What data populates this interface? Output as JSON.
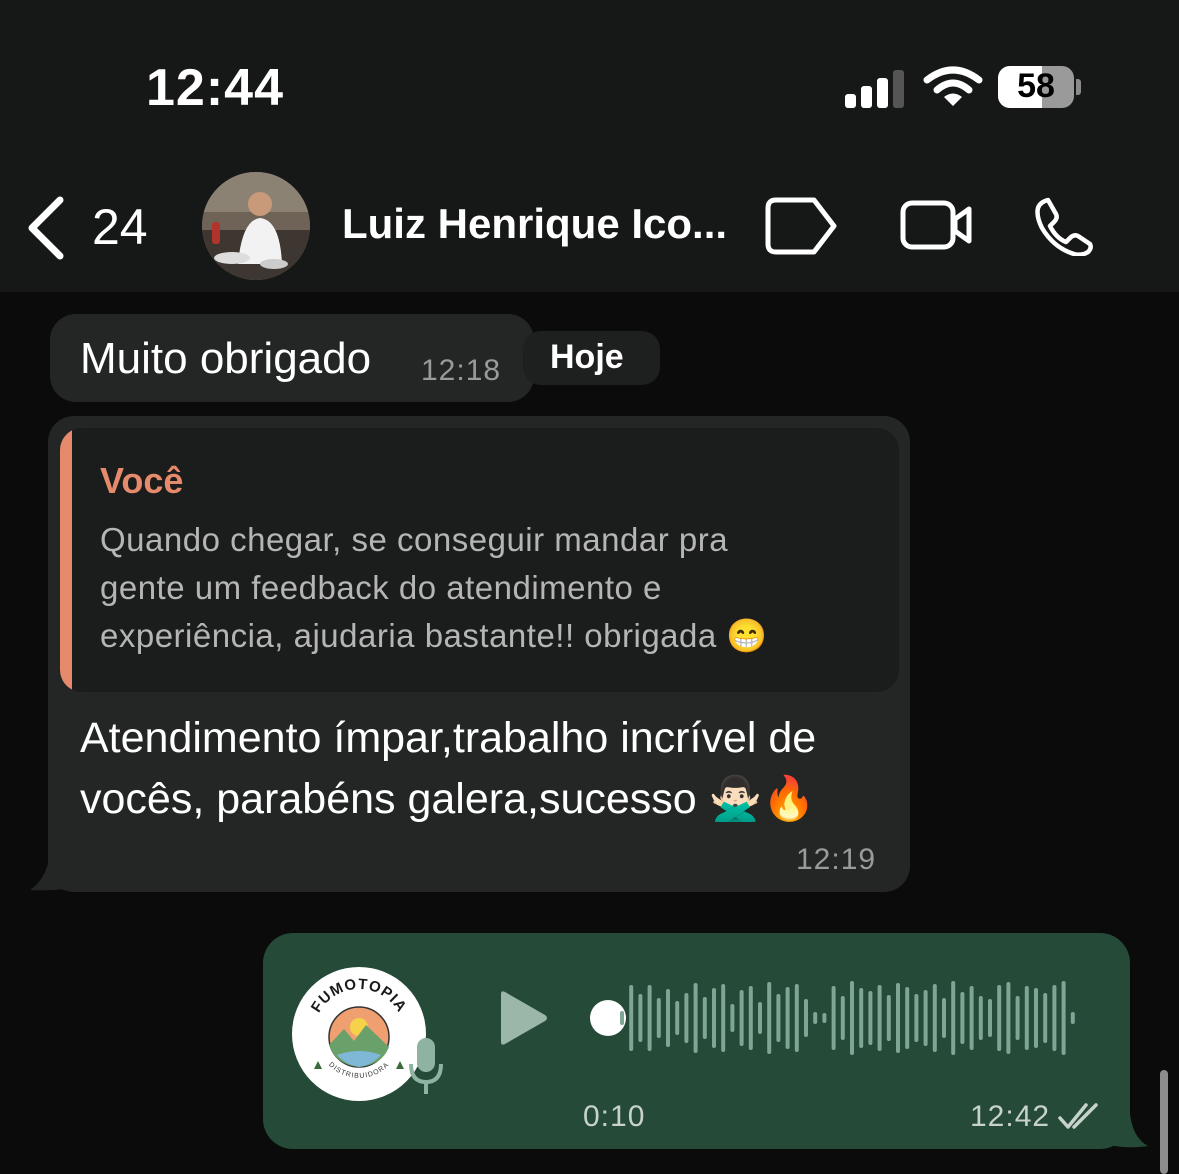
{
  "status_bar": {
    "time": "12:44",
    "battery_level": "58",
    "battery_fraction": 0.58
  },
  "header": {
    "back_count": "24",
    "contact_name": "Luiz Henrique Ico..."
  },
  "date_separator": "Hoje",
  "messages": [
    {
      "direction": "incoming",
      "text": "Muito obrigado",
      "time": "12:18"
    },
    {
      "direction": "incoming",
      "reply_to": {
        "author": "Você",
        "lines": [
          "Quando chegar, se conseguir mandar pra",
          "gente um feedback do atendimento e",
          "experiência, ajudaria bastante!! obrigada 😁"
        ]
      },
      "lines": [
        "Atendimento ímpar,trabalho incrível de",
        "vocês, parabéns galera,sucesso 🙅🏻‍♂️🔥"
      ],
      "time": "12:19"
    },
    {
      "direction": "outgoing",
      "type": "voice",
      "duration": "0:10",
      "time": "12:42",
      "status_icon": "double-check-icon",
      "avatar_text": "FUMOTOPIA",
      "avatar_subtext": "DISTRIBUIDORA"
    }
  ],
  "icons": {
    "back": "chevron-left-icon",
    "label": "tag-icon",
    "video": "video-camera-icon",
    "call": "phone-icon",
    "play": "play-icon",
    "mic": "microphone-icon"
  },
  "colors": {
    "incoming_bubble": "#242626",
    "outgoing_bubble": "#254a38",
    "quote_accent": "#e68a6c",
    "header_bg": "#161717",
    "chat_bg": "#0b0b0b"
  }
}
